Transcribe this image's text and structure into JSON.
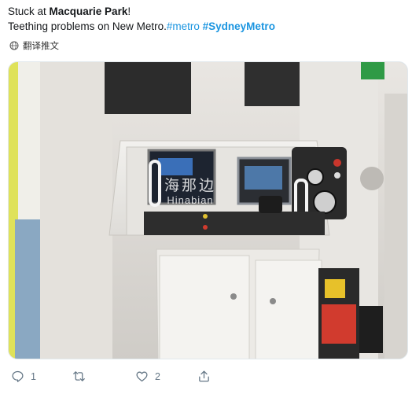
{
  "tweet": {
    "line1_prefix": "Stuck at ",
    "line1_bold": "Macquarie Park",
    "line1_suffix": "!",
    "line2_text": "Teething problems on New Metro.",
    "hashtag1": "#metro",
    "hashtag2": "#SydneyMetro"
  },
  "translate": {
    "label": "翻译推文",
    "icon": "globe-icon"
  },
  "media": {
    "watermark_cn": "海那边",
    "watermark_en": "Hinabian"
  },
  "actions": {
    "reply_count": "1",
    "retweet_count": "",
    "like_count": "2",
    "reply_icon": "reply-icon",
    "retweet_icon": "retweet-icon",
    "like_icon": "heart-icon",
    "share_icon": "share-icon"
  },
  "colors": {
    "hashtag": "#1b95e0",
    "icon_gray": "#657786",
    "text": "#14171a"
  }
}
